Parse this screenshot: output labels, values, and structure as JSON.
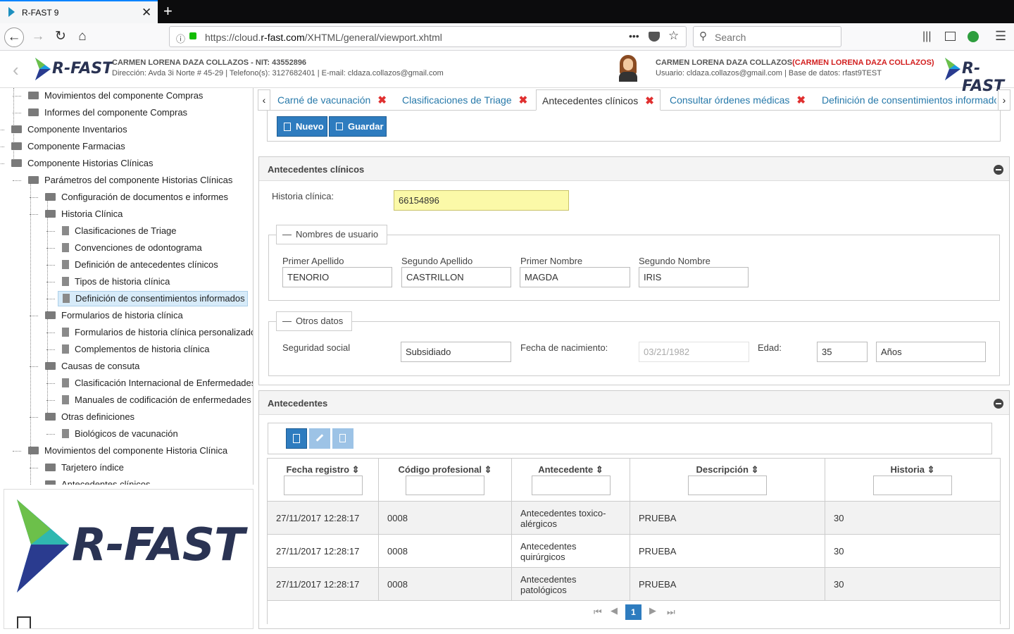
{
  "browser": {
    "tab_title": "R-FAST 9",
    "tab_close": "✕",
    "new_tab": "+",
    "url_prefix": "https://cloud.",
    "url_domain": "r-fast.com",
    "url_path": "/XHTML/general/viewport.xhtml",
    "url_dots": "•••",
    "search_placeholder": "Search"
  },
  "header": {
    "logo": "R-FAST",
    "company_line": "CARMEN LORENA DAZA COLLAZOS - NIT: 43552896",
    "address_line": "Dirección: Avda 3i Norte # 45-29 | Telefono(s): 3127682401 | E-mail: cldaza.collazos@gmail.com",
    "user_name": "CARMEN LORENA DAZA COLLAZOS",
    "user_name_paren": "(CARMEN LORENA DAZA COLLAZOS)",
    "user_line": "Usuario: cldaza.collazos@gmail.com | Base de datos: rfast9TEST"
  },
  "tree": [
    {
      "label": "Movimientos del componente Compras",
      "type": "folder"
    },
    {
      "label": "Informes del componente Compras",
      "type": "folder"
    },
    {
      "label": "Componente Inventarios",
      "type": "folder"
    },
    {
      "label": "Componente Farmacias",
      "type": "folder"
    },
    {
      "label": "Componente Historias Clínicas",
      "type": "folder"
    },
    {
      "label": "Parámetros del componente Historias Clínicas",
      "type": "folder"
    },
    {
      "label": "Configuración de documentos e informes",
      "type": "folder"
    },
    {
      "label": "Historia Clínica",
      "type": "folder"
    },
    {
      "label": "Clasificaciones de Triage",
      "type": "doc"
    },
    {
      "label": "Convenciones de odontograma",
      "type": "doc"
    },
    {
      "label": "Definición de antecedentes clínicos",
      "type": "doc"
    },
    {
      "label": "Tipos de historia clínica",
      "type": "doc"
    },
    {
      "label": "Definición de consentimientos informados",
      "type": "doc"
    },
    {
      "label": "Formularios de historia clínica",
      "type": "folder"
    },
    {
      "label": "Formularios de historia clínica personalizados",
      "type": "doc"
    },
    {
      "label": "Complementos de historia clínica",
      "type": "doc"
    },
    {
      "label": "Causas de consuta",
      "type": "folder"
    },
    {
      "label": "Clasificación Internacional de Enfermedades",
      "type": "doc"
    },
    {
      "label": "Manuales de codificación de enfermedades",
      "type": "doc"
    },
    {
      "label": "Otras definiciones",
      "type": "folder"
    },
    {
      "label": "Biológicos de vacunación",
      "type": "doc"
    },
    {
      "label": "Movimientos del componente Historia Clínica",
      "type": "folder"
    },
    {
      "label": "Tarjetero índice",
      "type": "folder"
    },
    {
      "label": "Antecedentes clínicos",
      "type": "folder"
    }
  ],
  "brand_logo": "R-FAST",
  "tabs": [
    {
      "label": "Carné de vacunación"
    },
    {
      "label": "Clasificaciones de Triage"
    },
    {
      "label": "Antecedentes clínicos"
    },
    {
      "label": "Consultar órdenes médicas"
    },
    {
      "label": "Definición de consentimientos informados"
    }
  ],
  "tab_close": "✖",
  "toolbar": {
    "new": "Nuevo",
    "save": "Guardar"
  },
  "form": {
    "panel_title": "Antecedentes clínicos",
    "historia_label": "Historia clínica:",
    "historia_value": "66154896",
    "names_legend": "Nombres de usuario",
    "primer_apellido_label": "Primer Apellido",
    "primer_apellido": "TENORIO",
    "segundo_apellido_label": "Segundo Apellido",
    "segundo_apellido": "CASTRILLON",
    "primer_nombre_label": "Primer Nombre",
    "primer_nombre": "MAGDA",
    "segundo_nombre_label": "Segundo Nombre",
    "segundo_nombre": "IRIS",
    "otros_legend": "Otros datos",
    "seguridad_label": "Seguridad social",
    "seguridad_value": "Subsidiado",
    "fecha_label": "Fecha de nacimiento:",
    "fecha_value": "03/21/1982",
    "edad_label": "Edad:",
    "edad_value": "35",
    "edad_unit": "Años"
  },
  "antecedentes": {
    "panel_title": "Antecedentes",
    "columns": [
      "Fecha registro",
      "Código profesional",
      "Antecedente",
      "Descripción",
      "Historia"
    ],
    "rows": [
      [
        "27/11/2017 12:28:17",
        "0008",
        "Antecedentes toxico-alérgicos",
        "PRUEBA",
        "30"
      ],
      [
        "27/11/2017 12:28:17",
        "0008",
        "Antecedentes quirúrgicos",
        "PRUEBA",
        "30"
      ],
      [
        "27/11/2017 12:28:17",
        "0008",
        "Antecedentes patológicos",
        "PRUEBA",
        "30"
      ]
    ],
    "page": "1",
    "sort_icon": "⇕"
  }
}
